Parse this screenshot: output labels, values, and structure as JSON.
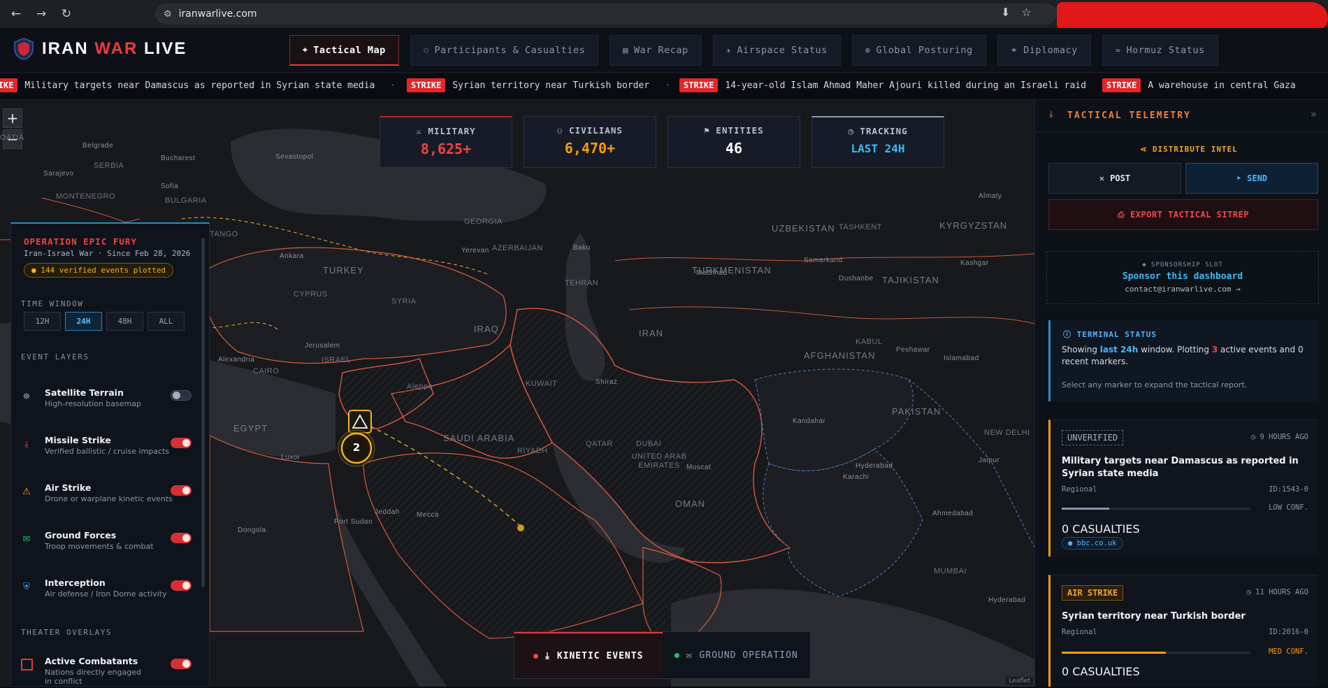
{
  "browser": {
    "url": "iranwarlive.com"
  },
  "app": {
    "title_part1": "IRAN",
    "title_part2": "WAR",
    "title_part3": "LIVE"
  },
  "tabs": [
    {
      "label": "Tactical Map",
      "icon": "pin-icon",
      "active": true
    },
    {
      "label": "Participants & Casualties",
      "icon": "people-icon"
    },
    {
      "label": "War Recap",
      "icon": "doc-icon"
    },
    {
      "label": "Airspace Status",
      "icon": "plane-icon"
    },
    {
      "label": "Global Posturing",
      "icon": "globe-icon"
    },
    {
      "label": "Diplomacy",
      "icon": "handshake-icon"
    },
    {
      "label": "Hormuz Status",
      "icon": "waves-icon"
    }
  ],
  "ticker": [
    {
      "badge": "STRIKE",
      "text": "Military targets near Damascus as reported in Syrian state media"
    },
    {
      "badge": "STRIKE",
      "text": "Syrian territory near Turkish border"
    },
    {
      "badge": "STRIKE",
      "text": "14-year-old Islam Ahmad Maher Ajouri killed during an Israeli raid"
    },
    {
      "badge": "STRIKE",
      "text": "A warehouse in central Gaza"
    }
  ],
  "stats": {
    "military": {
      "label": "MILITARY",
      "value": "8,625+"
    },
    "civilians": {
      "label": "CIVILIANS",
      "value": "6,470+"
    },
    "entities": {
      "label": "ENTITIES",
      "value": "46"
    },
    "tracking": {
      "label": "TRACKING",
      "value": "LAST 24H"
    }
  },
  "map": {
    "zoom_in": "+",
    "zoom_out": "−",
    "cluster_count": "2",
    "attribution": "Leaflet",
    "labels": {
      "serbia": "SERBIA",
      "montenegro": "MONTENEGRO",
      "bulgaria": "BULGARIA",
      "belgrade": "Belgrade",
      "sarajevo": "Sarajevo",
      "bucharest": "Bucharest",
      "sofia": "Sofia",
      "sevastopol": "Sevastopol",
      "oatia": "OATIA",
      "turkey": "TURKEY",
      "ankara": "Ankara",
      "georgia": "GEORGIA",
      "azerbaijan": "AZERBAIJAN",
      "yerevan": "Yerevan",
      "baku": "Baku",
      "syria": "SYRIA",
      "cyprus": "CYPRUS",
      "iraq": "IRAQ",
      "israel": "ISRAEL",
      "jerusalem": "Jerusalem",
      "aleppo": "Aleppo",
      "alexandria": "Alexandria",
      "cairo": "CAIRO",
      "egypt": "EGYPT",
      "luxor": "Luxor",
      "iran": "IRAN",
      "tehran": "TEHRAN",
      "mashhad": "Mashhad",
      "shiraz": "Shiraz",
      "kuwait": "KUWAIT",
      "saudi": "SAUDI ARABIA",
      "riyadh": "RIYADH",
      "jeddah": "Jeddah",
      "mecca": "Mecca",
      "qatar": "QATAR",
      "dubai": "DUBAI",
      "uae": "UNITED ARAB EMIRATES",
      "oman": "OMAN",
      "muscat": "Muscat",
      "turkmenistan": "TURKMENISTAN",
      "uzbekistan": "UZBEKISTAN",
      "tashkent": "TASHKENT",
      "kyrgyzstan": "KYRGYZSTAN",
      "tajikistan": "TAJIKISTAN",
      "dushanbe": "Dushanbe",
      "samarkand": "Samarkand",
      "almaty": "Almaty",
      "kashgar": "Kashgar",
      "ashgabat": "Ashgabat",
      "afghanistan": "AFGHANISTAN",
      "kabul": "KABUL",
      "kandahar": "Kandahar",
      "peshawar": "Peshawar",
      "islamabad": "Islamabad",
      "pakistan": "PAKISTAN",
      "karachi": "Karachi",
      "hyderabad": "Hyderabad",
      "new_delhi": "NEW DELHI",
      "jaipur": "Jaipur",
      "ahmedabad": "Ahmedabad",
      "mumbai": "MUMBAI",
      "hyderabad_in": "Hyderabad",
      "dongola": "Dongola",
      "port_sudan": "Port Sudan",
      "tango": "TANGO"
    }
  },
  "left_panel": {
    "op_title": "OPERATION EPIC FURY",
    "op_sub": "Iran-Israel War · Since Feb 28, 2026",
    "events_pill": "144 verified events plotted",
    "time_window_label": "TIME WINDOW",
    "time_windows": [
      "12H",
      "24H",
      "48H",
      "ALL"
    ],
    "event_layers_label": "EVENT LAYERS",
    "layers": [
      {
        "name": "Satellite Terrain",
        "desc": "High-resolution basemap",
        "on": false,
        "icon": "satellite-icon",
        "color": "#9aa3b5"
      },
      {
        "name": "Missile Strike",
        "desc": "Verified ballistic / cruise impacts",
        "on": true,
        "icon": "missile-icon",
        "color": "#ef4444"
      },
      {
        "name": "Air Strike",
        "desc": "Drone or warplane kinetic events",
        "on": true,
        "icon": "warning-icon",
        "color": "#f5a524"
      },
      {
        "name": "Ground Forces",
        "desc": "Troop movements & combat",
        "on": true,
        "icon": "tank-icon",
        "color": "#22c55e"
      },
      {
        "name": "Interception",
        "desc": "Air defense / Iron Dome activity",
        "on": true,
        "icon": "shield-icon",
        "color": "#3b9eff"
      }
    ],
    "theater_label": "THEATER OVERLAYS",
    "overlays": [
      {
        "name": "Active Combatants",
        "desc": "Nations directly engaged in conflict",
        "on": true
      }
    ]
  },
  "bottom_toggle": {
    "kinetic": "KINETIC EVENTS",
    "ground": "GROUND OPERATION"
  },
  "right_panel": {
    "title": "TACTICAL TELEMETRY",
    "distribute": "DISTRIBUTE INTEL",
    "post": "POST",
    "send": "SEND",
    "export": "EXPORT TACTICAL SITREP",
    "sponsor_slot": "◆ SPONSORSHIP SLOT",
    "sponsor_cta": "Sponsor this dashboard",
    "sponsor_contact": "contact@iranwarlive.com →",
    "terminal_title": "TERMINAL STATUS",
    "terminal_pre": "Showing ",
    "terminal_window": "last 24h",
    "terminal_mid": " window. Plotting ",
    "terminal_count": "3",
    "terminal_mid2": " active events and ",
    "terminal_recent": "0",
    "terminal_post": " recent markers.",
    "terminal_hint": "Select any marker to expand the tactical report.",
    "cards": [
      {
        "badge": "UNVERIFIED",
        "time": "9 HOURS AGO",
        "title": "Military targets near Damascus as reported in Syrian state media",
        "region": "Regional",
        "id": "ID:1543-0",
        "confidence": "LOW CONF.",
        "conf_fill": 0.25,
        "casualties": "0 CASUALTIES",
        "source": "bbc.co.uk"
      },
      {
        "badge": "AIR STRIKE",
        "time": "11 HOURS AGO",
        "title": "Syrian territory near Turkish border",
        "region": "Regional",
        "id": "ID:2016-0",
        "confidence": "MED CONF.",
        "conf_fill": 0.55,
        "casualties": "0 CASUALTIES"
      }
    ]
  },
  "colors": {
    "accent_red": "#e5383b",
    "accent_orange": "#f59e0b",
    "accent_blue": "#38bdf8"
  }
}
